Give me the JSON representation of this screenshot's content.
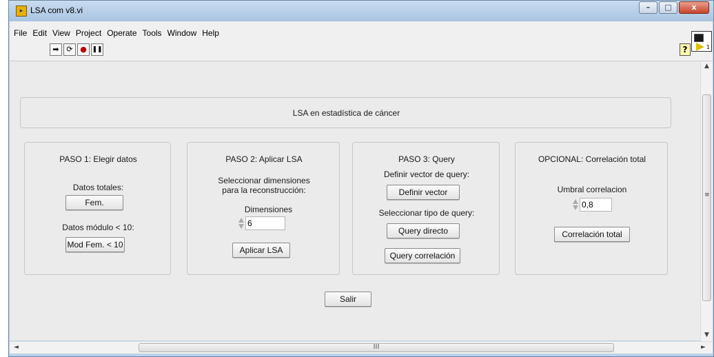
{
  "window": {
    "title": "LSA com v8.vi",
    "app_icon": "labview-vi-icon"
  },
  "window_buttons": {
    "minimize": "–",
    "maximize": "□",
    "close": "x"
  },
  "menubar": [
    "File",
    "Edit",
    "View",
    "Project",
    "Operate",
    "Tools",
    "Window",
    "Help"
  ],
  "toolbar": {
    "icons": [
      "run-arrow-icon",
      "run-continuously-icon",
      "abort-icon",
      "pause-icon"
    ],
    "run": "➡",
    "run_continuous": "⟳",
    "abort": "●",
    "pause": "❚❚",
    "help": "?",
    "vi_icon_number": "1"
  },
  "header": {
    "title": "LSA en estadística de cáncer"
  },
  "paso1": {
    "title": "PASO 1: Elegir datos",
    "datos_totales_label": "Datos totales:",
    "fem_button": "Fem.",
    "datos_modulo_label": "Datos módulo < 10:",
    "mod_fem_button": "Mod Fem. < 10"
  },
  "paso2": {
    "title": "PASO 2: Aplicar LSA",
    "desc_line1": "Seleccionar dimensiones",
    "desc_line2": "para la reconstrucción:",
    "dim_label": "Dimensiones",
    "dim_value": "6",
    "apply_button": "Aplicar LSA"
  },
  "paso3": {
    "title": "PASO 3: Query",
    "define_label": "Definir vector de query:",
    "define_button": "Definir vector",
    "select_label": "Seleccionar tipo de query:",
    "direct_button": "Query directo",
    "correl_button": "Query correlación"
  },
  "opcional": {
    "title": "OPCIONAL: Correlación total",
    "umbral_label": "Umbral correlacion",
    "umbral_value": "0,8",
    "total_button": "Correlación total"
  },
  "exit_button": "Salir",
  "scroll": {
    "h_thumb_grip": "III",
    "up": "▲",
    "down": "▼",
    "left": "◄",
    "right": "►",
    "grip": "≡"
  },
  "colors": {
    "panel_bg": "#ebebeb",
    "titlebar": "#bcd2ea",
    "close_button": "#c7432a"
  }
}
